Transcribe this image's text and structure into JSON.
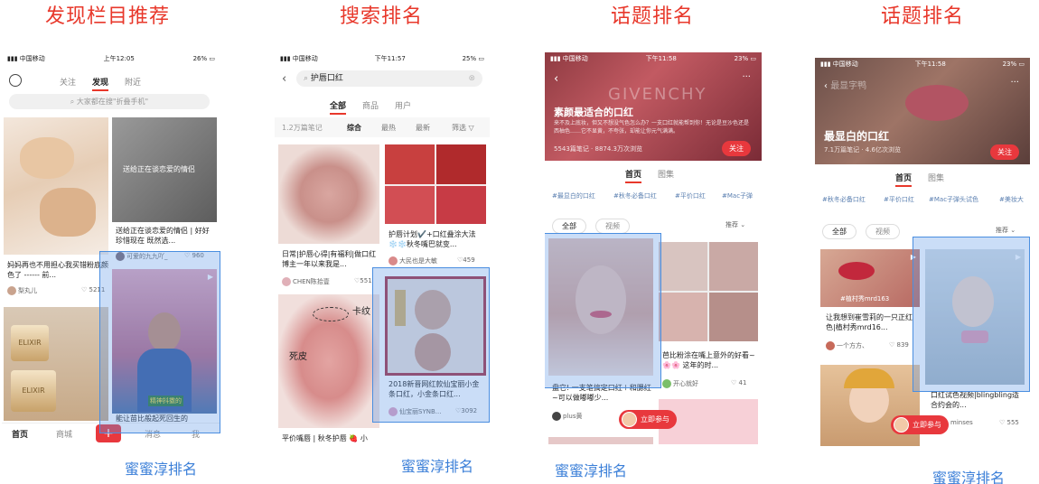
{
  "titles": [
    "发现栏目推荐",
    "搜索排名",
    "话题排名",
    "话题排名"
  ],
  "rank_label": "蜜蜜淳排名",
  "p1": {
    "carrier": "中国移动",
    "time": "上午12:05",
    "battery": "26%",
    "tabs": [
      "关注",
      "发现",
      "附近"
    ],
    "search_placeholder": "大家都在搜\"折叠手机\"",
    "card2_overlay": "送给正在谈恋爱的情侣",
    "card2_title": "送给正在谈恋爱的情侣 | 好好珍惜现在 既然选...",
    "card2_user": "可爱的九九吖_",
    "card2_likes": "960",
    "card1_title": "妈妈再也不用担心我买错粉底颜色了 ------ 前...",
    "card1_user": "梨丸儿",
    "card1_likes": "5211",
    "card4_overlay": "精神抖擞的",
    "card4_title": "能让苗比般起死回生的",
    "nav": [
      "首页",
      "商城",
      "+",
      "消息",
      "我"
    ]
  },
  "p2": {
    "carrier": "中国移动",
    "time": "下午11:57",
    "battery": "25%",
    "query": "护唇口红",
    "tabs": [
      "全部",
      "商品",
      "用户"
    ],
    "count": "1.2万篇笔记",
    "sorts": [
      "综合",
      "最热",
      "最新"
    ],
    "filter": "筛选",
    "left1_title": "日常|护唇心得|有福利|做口红博主一年以来我是...",
    "left1_user": "CHEN陈拾壹",
    "left1_likes": "551",
    "annot1": "卡纹",
    "annot2": "死皮",
    "left2_title": "平价嘴唇 | 秋冬护唇 🍓 小",
    "right1_title": "护唇计划✔️+口红叠涂大法 ❄️❄️秋冬嘴巴就变...",
    "right1_user": "大民也是大敏",
    "right1_likes": "459",
    "right2_title": "2018新晋网红款仙宝丽小金条口红，小金条口红...",
    "right2_user": "仙宝丽SYNB...",
    "right2_likes": "3092"
  },
  "p3": {
    "carrier": "中国移动",
    "time": "下午11:58",
    "battery": "23%",
    "brand_watermark": "GIVENCHY",
    "topic": "素颜最适合的口红",
    "desc": "来不及上底妆，但又不想没气色怎么办？一支口红就能帮到你！无论是豆沙色还是西柚色……它不显黄，不夸张，却能让你元气满满。",
    "stats": "5543篇笔记 · 8874.3万次浏览",
    "follow": "关注",
    "tabs": [
      "首页",
      "图集"
    ],
    "tags": [
      "#最显白的口红",
      "#秋冬必备口红",
      "#平价口红",
      "#Mac子弹"
    ],
    "filters": [
      "全部",
      "视频"
    ],
    "sort": "推荐",
    "left_title": "盘它! 一支笔搞定口红＋和腮红~可以做嘟嘟少...",
    "left_user": "plus黄",
    "right_title": "芭比粉涂在嘴上意外的好看~ 🌸🌸 这年的时...",
    "right_user": "开心就好",
    "right_likes": "41",
    "join": "立即参与"
  },
  "p4": {
    "carrier": "中国移动",
    "time": "下午11:58",
    "battery": "23%",
    "nav_title": "最显字鸭",
    "topic": "最显白的口红",
    "stats": "7.1万篇笔记 · 4.6亿次浏览",
    "follow": "关注",
    "tabs": [
      "首页",
      "图集"
    ],
    "tags": [
      "#秋冬必备口红",
      "#平价口红",
      "#Mac子弹头试色",
      "#美妆大"
    ],
    "filters": [
      "全部",
      "视频"
    ],
    "sort": "推荐",
    "left_badge": "#植村秀mrd163",
    "left_title": "让我想到崔雪莉的一只正红色|植村秀mrd16...",
    "left_user": "一个方方、",
    "left_likes": "839",
    "right_title": "口红试色视频|blingbling适合约会的...",
    "right_user": "minses",
    "right_likes": "555",
    "join": "立即参与"
  }
}
